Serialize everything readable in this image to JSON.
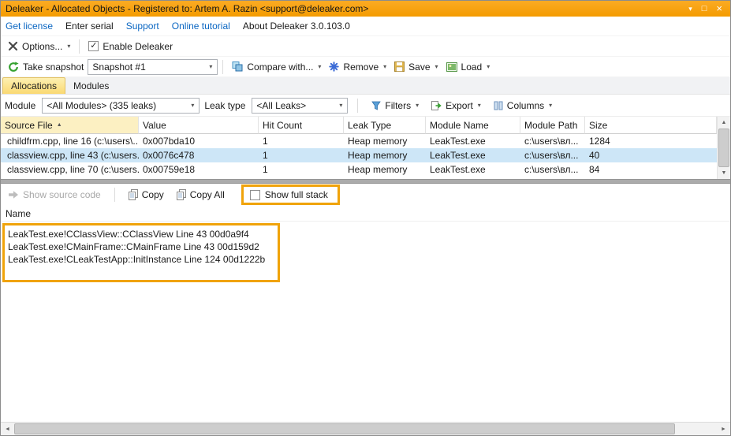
{
  "window": {
    "title": "Deleaker - Allocated Objects - Registered to: Artem A. Razin <support@deleaker.com>",
    "menu_glyph": "▾",
    "maximize_glyph": "□",
    "close_glyph": "×"
  },
  "icons": {
    "dropdown": "▾",
    "sort_asc": "▲",
    "check": "✓",
    "scroll_up": "▲",
    "scroll_down": "▼",
    "scroll_left": "◄",
    "scroll_right": "►"
  },
  "linkbar": {
    "get_license": "Get license",
    "enter_serial": "Enter serial",
    "support": "Support",
    "online_tutorial": "Online tutorial",
    "about": "About Deleaker 3.0.103.0"
  },
  "options_bar": {
    "options": "Options...",
    "enable_deleaker": "Enable Deleaker"
  },
  "snapshot_bar": {
    "take_snapshot": "Take snapshot",
    "snapshot_value": "Snapshot #1",
    "compare_with": "Compare with...",
    "remove": "Remove",
    "save": "Save",
    "load": "Load"
  },
  "tabs": {
    "allocations": "Allocations",
    "modules": "Modules"
  },
  "filter_bar": {
    "module_label": "Module",
    "module_value": "<All Modules> (335 leaks)",
    "leak_type_label": "Leak type",
    "leak_type_value": "<All Leaks>",
    "filters": "Filters",
    "export": "Export",
    "columns": "Columns"
  },
  "grid": {
    "headers": {
      "source_file": "Source File",
      "value": "Value",
      "hit_count": "Hit Count",
      "leak_type": "Leak Type",
      "module_name": "Module Name",
      "module_path": "Module Path",
      "size": "Size"
    },
    "rows": [
      {
        "source_file": "childfrm.cpp, line 16 (c:\\users\\...",
        "value": "0x007bda10",
        "hit_count": "1",
        "leak_type": "Heap memory",
        "module_name": "LeakTest.exe",
        "module_path": "c:\\users\\вл...",
        "size": "1284"
      },
      {
        "source_file": "classview.cpp, line 43 (c:\\users...",
        "value": "0x0076c478",
        "hit_count": "1",
        "leak_type": "Heap memory",
        "module_name": "LeakTest.exe",
        "module_path": "c:\\users\\вл...",
        "size": "40"
      },
      {
        "source_file": "classview.cpp, line 70 (c:\\users...",
        "value": "0x00759e18",
        "hit_count": "1",
        "leak_type": "Heap memory",
        "module_name": "LeakTest.exe",
        "module_path": "c:\\users\\вл...",
        "size": "84"
      }
    ]
  },
  "stack_bar": {
    "show_source_code": "Show source code",
    "copy": "Copy",
    "copy_all": "Copy All",
    "show_full_stack": "Show full stack"
  },
  "stack": {
    "header": "Name",
    "frames": [
      "LeakTest.exe!CClassView::CClassView Line 43 00d0a9f4",
      "LeakTest.exe!CMainFrame::CMainFrame Line 43 00d159d2",
      "LeakTest.exe!CLeakTestApp::InitInstance Line 124 00d1222b"
    ]
  }
}
